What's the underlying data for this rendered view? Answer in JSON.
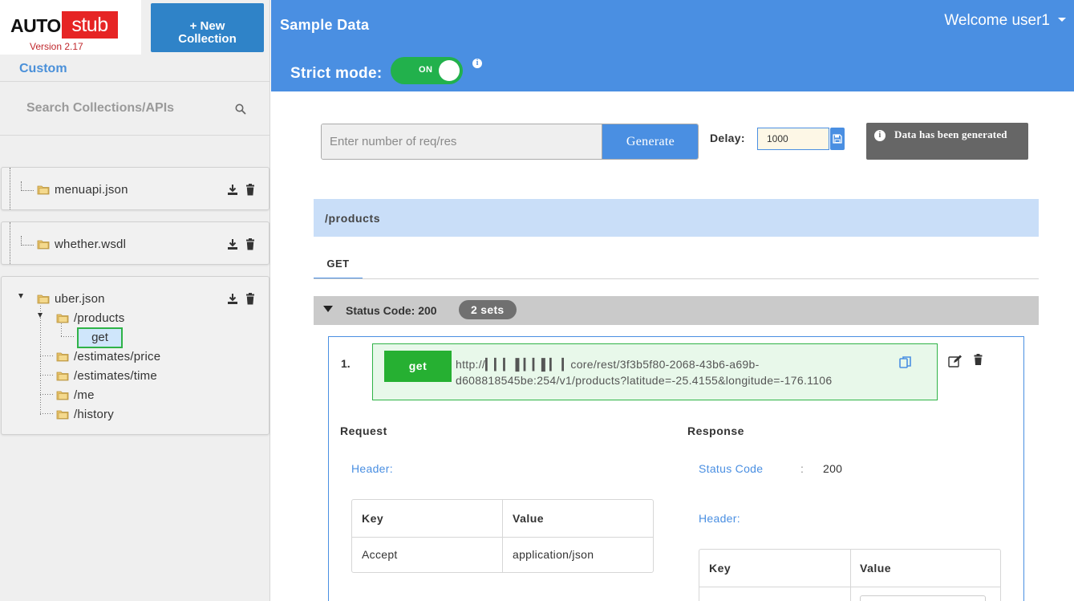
{
  "app": {
    "logo_auto": "AUTO",
    "logo_stub": "stub",
    "version": "Version 2.17",
    "new_collection": "+ New\nCollection"
  },
  "sidebar": {
    "group_label": "Custom",
    "search_placeholder": "Search Collections/APIs",
    "collections": [
      {
        "name": "menuapi.json"
      },
      {
        "name": "whether.wsdl"
      },
      {
        "name": "uber.json",
        "children": [
          {
            "label": "/products",
            "children": [
              {
                "label": "get",
                "selected": true
              }
            ]
          },
          {
            "label": "/estimates/price"
          },
          {
            "label": "/estimates/time"
          },
          {
            "label": "/me"
          },
          {
            "label": "/history"
          }
        ]
      }
    ]
  },
  "header": {
    "title": "Sample Data",
    "welcome": "Welcome user1",
    "strict_mode_label": "Strict mode:",
    "strict_mode_state": "ON"
  },
  "generator": {
    "input_placeholder": "Enter number of req/res",
    "generate_label": "Generate",
    "delay_label": "Delay:",
    "delay_value": "1000",
    "toast": "Data has been generated"
  },
  "endpoint": {
    "path": "/products",
    "tab": "GET",
    "status_label": "Status Code: 200",
    "sets_badge": "2 sets",
    "item": {
      "index": "1.",
      "method": "get",
      "url": "http://▎▎▎ ▌▎▎▌▎ ▎core/rest/3f3b5f80-2068-43b6-a69b-d608818545be:254/v1/products?latitude=-25.4155&longitude=-176.1106"
    },
    "request": {
      "title": "Request",
      "header_label": "Header:",
      "table": {
        "key_header": "Key",
        "value_header": "Value",
        "rows": [
          {
            "key": "Accept",
            "value": "application/json"
          }
        ]
      }
    },
    "response": {
      "title": "Response",
      "status_label": "Status Code",
      "status_sep": ":",
      "status_value": "200",
      "header_label": "Header:",
      "table": {
        "key_header": "Key",
        "value_header": "Value"
      }
    }
  },
  "colors": {
    "accent": "#4a8fe2",
    "toggle_on": "#22b14c",
    "method_get": "#26b032",
    "logo_red": "#e62424"
  }
}
